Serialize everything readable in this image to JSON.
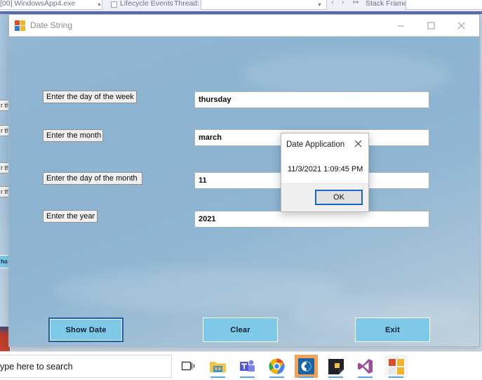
{
  "vs_toolbar": {
    "process_label": "[00] WindowsApp4.exe",
    "lifecycle_label": "Lifecycle Events",
    "thread_label": "Thread:",
    "stack_frame_label": "Stack Frame:"
  },
  "form": {
    "title": "Date String",
    "icon": "windows-forms-app-icon",
    "window_buttons": {
      "minimize": "minimize-icon",
      "maximize": "maximize-icon",
      "close": "close-icon"
    },
    "fields": [
      {
        "label": "Enter the day of the week",
        "value": "thursday"
      },
      {
        "label": "Enter the month",
        "value": "march"
      },
      {
        "label": "Enter the day of the month",
        "value": "11"
      },
      {
        "label": "Enter the year",
        "value": "2021"
      }
    ],
    "buttons": [
      {
        "label": "Show Date",
        "focused": true
      },
      {
        "label": "Clear",
        "focused": false
      },
      {
        "label": "Exit",
        "focused": false
      }
    ]
  },
  "messagebox": {
    "title": "Date Application",
    "close_icon": "close-icon",
    "message": "11/3/2021 1:09:45 PM",
    "ok_label": "OK"
  },
  "taskbar": {
    "search_placeholder": "ype here to search",
    "icons": [
      "task-view-icon",
      "file-explorer-icon",
      "microsoft-teams-icon",
      "google-chrome-icon",
      "blue-app-icon",
      "sticky-notes-icon",
      "visual-studio-icon",
      "windows-forms-app-icon"
    ]
  },
  "colors": {
    "form_background": "#8cb3d0",
    "button_fill": "#7ec8e8",
    "focus_border": "#1a5fa8",
    "msgbox_ok_border": "#1668c4",
    "taskbar_active": "#f4a259"
  }
}
